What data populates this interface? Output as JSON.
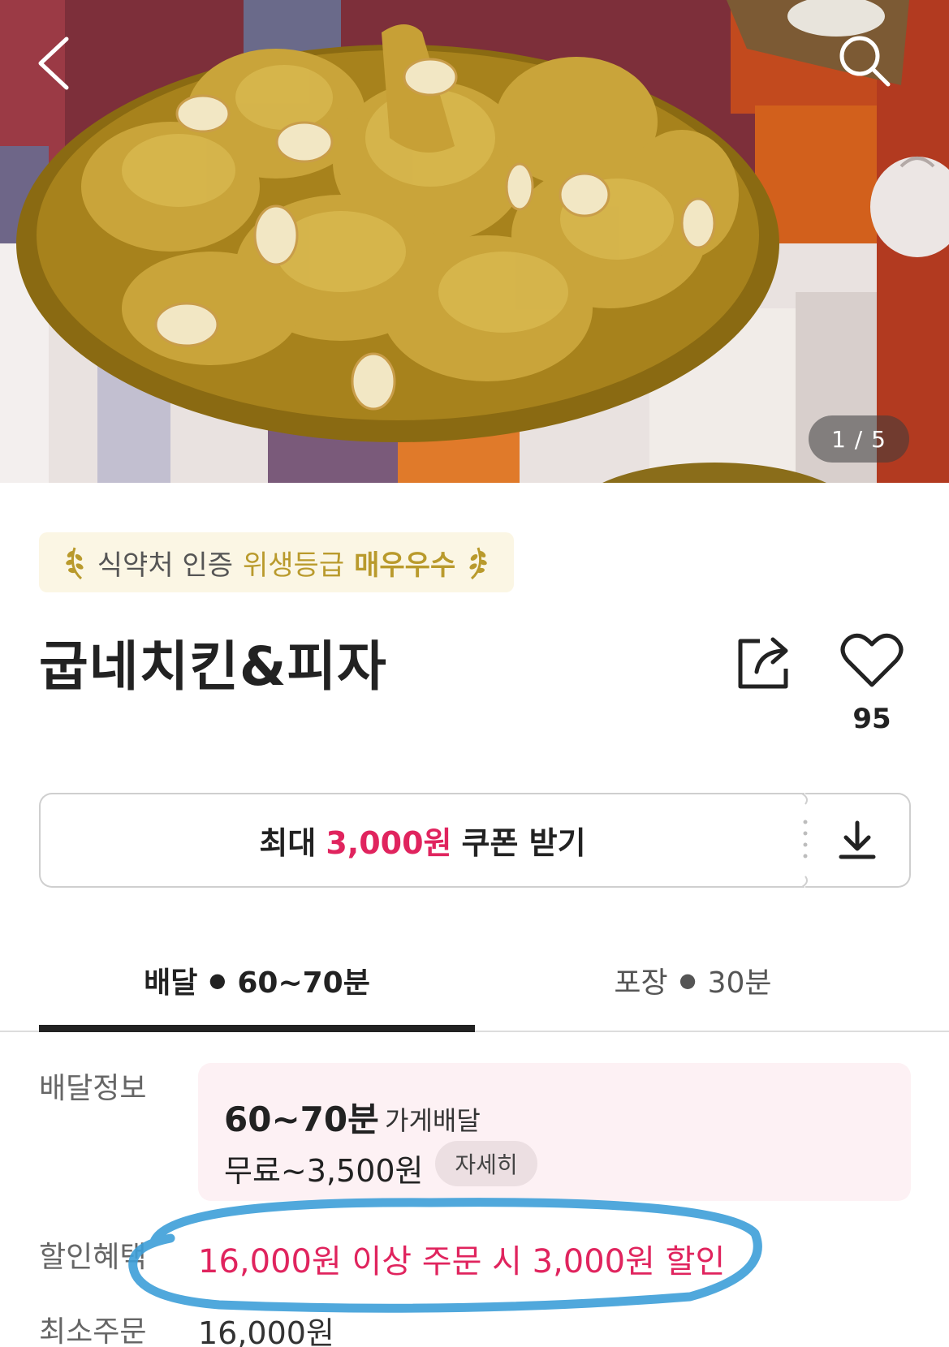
{
  "header": {
    "image_counter": "1 / 5"
  },
  "badge": {
    "prefix": "식약처 인증",
    "grade_label": "위생등급",
    "grade_value": "매우우수"
  },
  "store": {
    "name": "굽네치킨&피자",
    "favorite_count": "95"
  },
  "coupon": {
    "prefix": "최대",
    "amount": "3,000원",
    "suffix": "쿠폰 받기"
  },
  "tabs": [
    {
      "label": "배달",
      "time": "60~70분",
      "active": true
    },
    {
      "label": "포장",
      "time": "30분",
      "active": false
    }
  ],
  "delivery_info": {
    "label": "배달정보",
    "time": "60~70분",
    "type": "가게배달",
    "fee": "무료~3,500원",
    "detail_button": "자세히"
  },
  "discount": {
    "label": "할인혜택",
    "text": "16,000원 이상 주문 시 3,000원 할인"
  },
  "min_order": {
    "label": "최소주문",
    "value": "16,000원"
  },
  "colors": {
    "accent": "#e0245e",
    "badge_gold": "#b99a2c",
    "info_bg": "#fdf1f4",
    "highlight_marker": "#3d9fd8"
  },
  "icons": [
    "back-arrow-icon",
    "search-icon",
    "laurel-icon",
    "share-icon",
    "heart-icon",
    "download-icon"
  ]
}
